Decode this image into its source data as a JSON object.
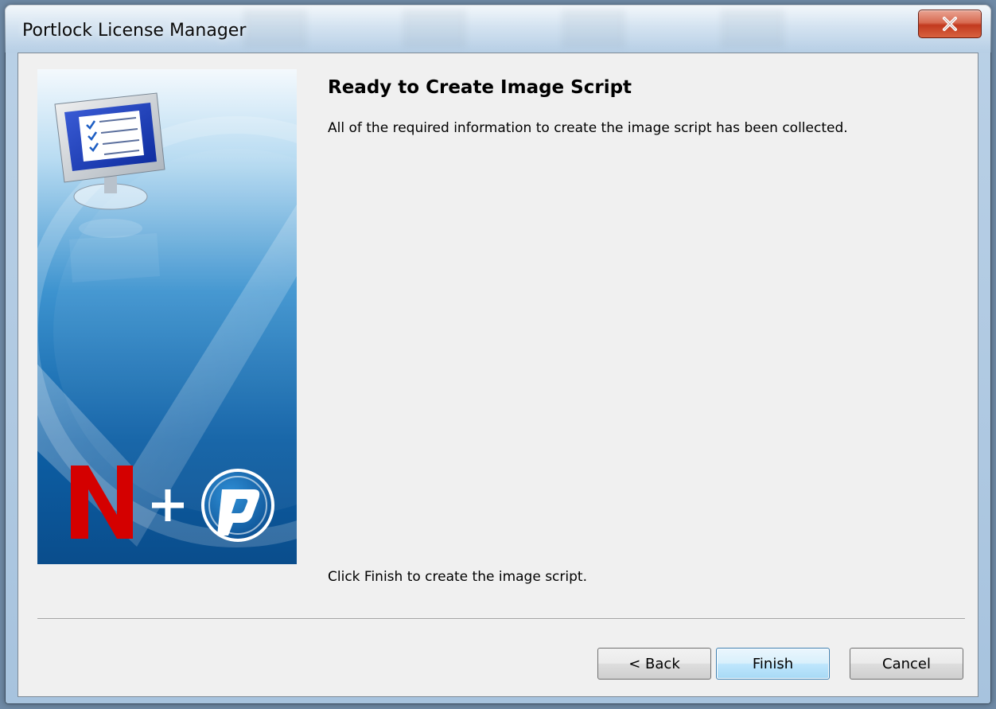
{
  "window": {
    "title": "Portlock License Manager"
  },
  "content": {
    "heading": "Ready to Create Image Script",
    "description": "All of the required information to create the image script has been collected.",
    "finish_hint": "Click Finish to create the image script."
  },
  "buttons": {
    "back": "< Back",
    "finish": "Finish",
    "cancel": "Cancel"
  },
  "icons": {
    "close": "close-icon",
    "banner": "wizard-banner-image",
    "monitor": "monitor-checklist-icon",
    "novell_logo": "novell-n-logo",
    "portlock_logo": "portlock-logo"
  },
  "colors": {
    "close_button": "#c23a1f",
    "banner_blue": "#0e5fa3",
    "novell_red": "#d40000",
    "default_button_border": "#3c7fb1"
  }
}
